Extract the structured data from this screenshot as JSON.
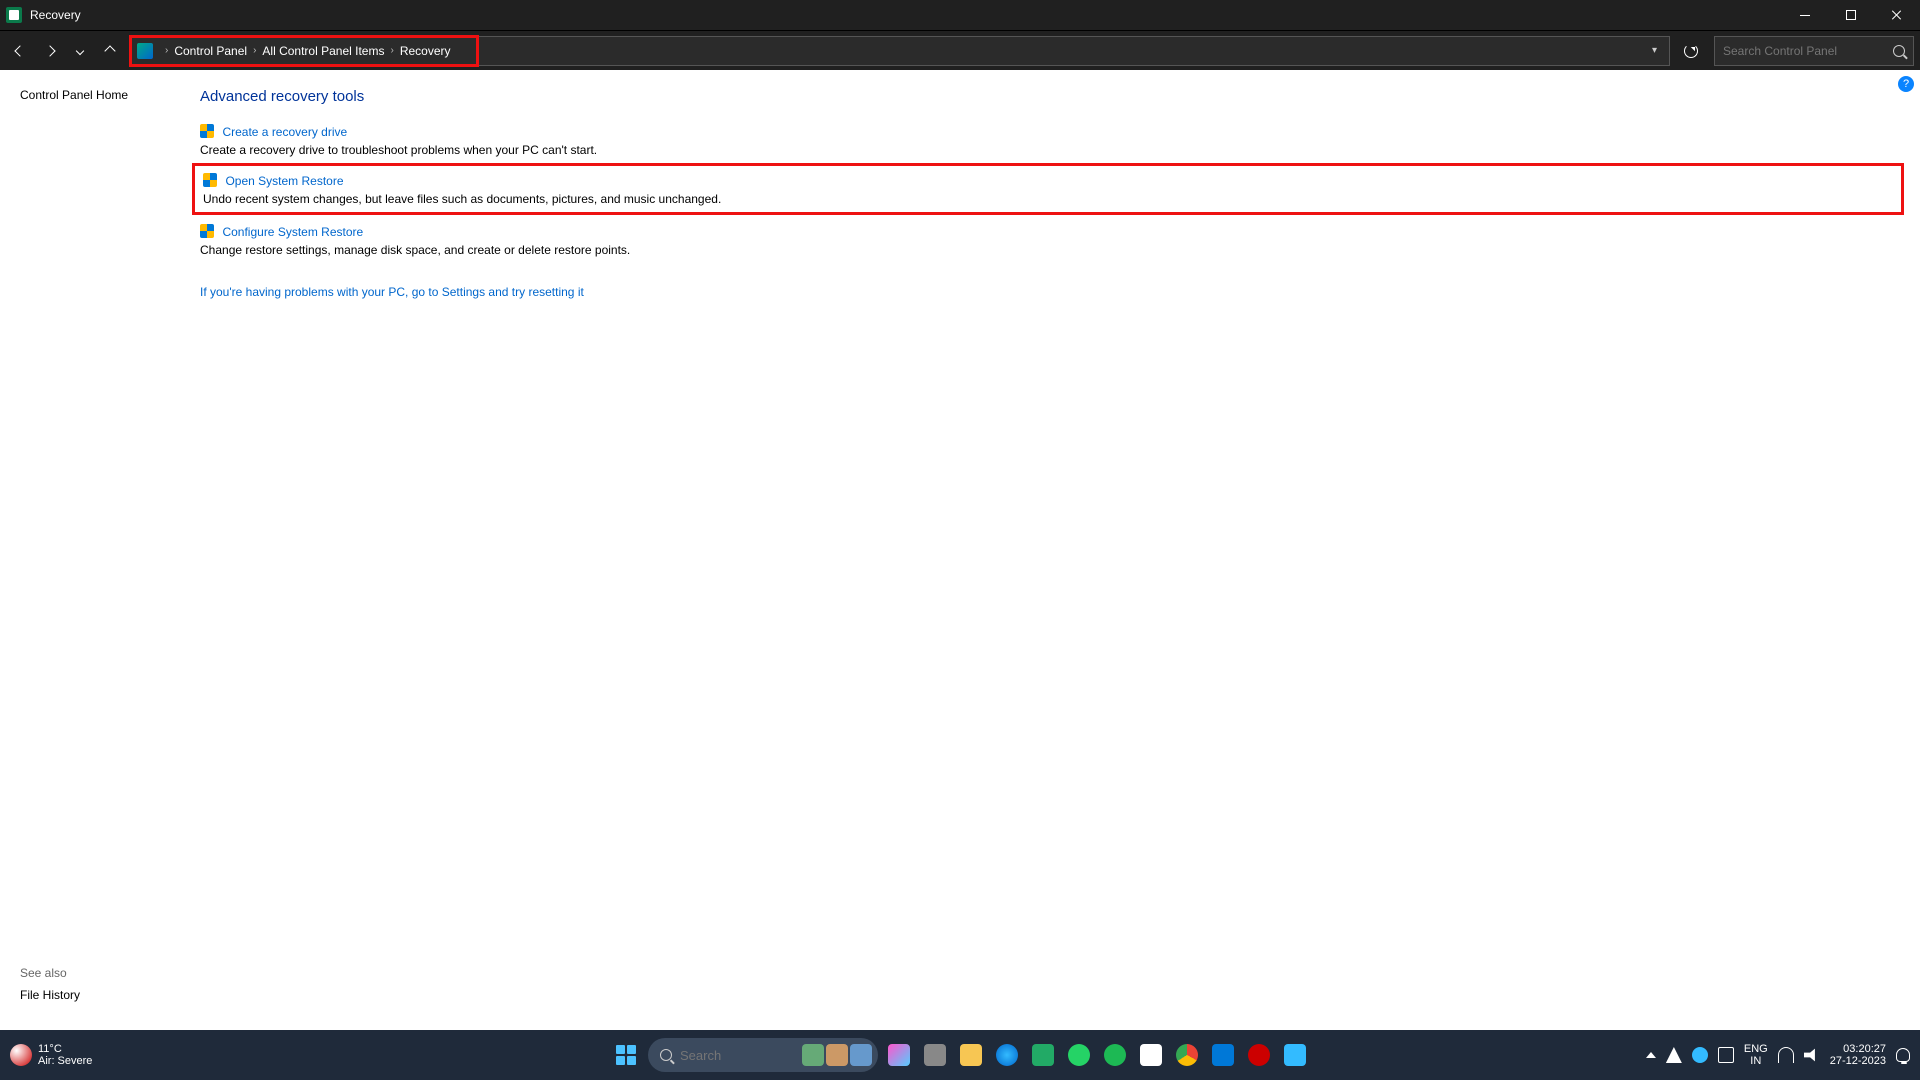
{
  "window": {
    "title": "Recovery"
  },
  "breadcrumb": {
    "items": [
      "Control Panel",
      "All Control Panel Items",
      "Recovery"
    ]
  },
  "search": {
    "placeholder": "Search Control Panel"
  },
  "sidebar": {
    "home": "Control Panel Home",
    "see_also_hdr": "See also",
    "see_also_link": "File History"
  },
  "main": {
    "heading": "Advanced recovery tools",
    "tools": [
      {
        "title": "Create a recovery drive",
        "desc": "Create a recovery drive to troubleshoot problems when your PC can't start."
      },
      {
        "title": "Open System Restore",
        "desc": "Undo recent system changes, but leave files such as documents, pictures, and music unchanged."
      },
      {
        "title": "Configure System Restore",
        "desc": "Change restore settings, manage disk space, and create or delete restore points."
      }
    ],
    "settings_link": "If you're having problems with your PC, go to Settings and try resetting it"
  },
  "taskbar": {
    "weather_temp": "11°C",
    "weather_state": "Air: Severe",
    "search_placeholder": "Search",
    "lang_top": "ENG",
    "lang_bot": "IN",
    "time": "03:20:27",
    "date": "27-12-2023"
  }
}
